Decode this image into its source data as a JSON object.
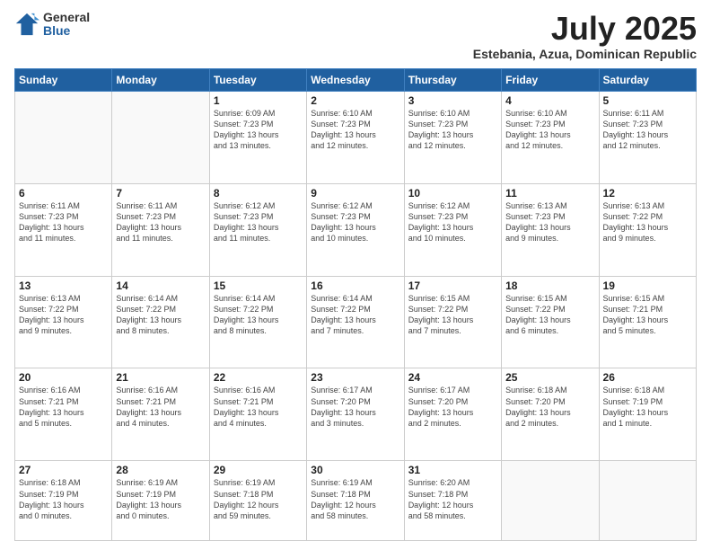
{
  "logo": {
    "general": "General",
    "blue": "Blue"
  },
  "header": {
    "month": "July 2025",
    "location": "Estebania, Azua, Dominican Republic"
  },
  "weekdays": [
    "Sunday",
    "Monday",
    "Tuesday",
    "Wednesday",
    "Thursday",
    "Friday",
    "Saturday"
  ],
  "weeks": [
    [
      {
        "day": "",
        "info": ""
      },
      {
        "day": "",
        "info": ""
      },
      {
        "day": "1",
        "info": "Sunrise: 6:09 AM\nSunset: 7:23 PM\nDaylight: 13 hours\nand 13 minutes."
      },
      {
        "day": "2",
        "info": "Sunrise: 6:10 AM\nSunset: 7:23 PM\nDaylight: 13 hours\nand 12 minutes."
      },
      {
        "day": "3",
        "info": "Sunrise: 6:10 AM\nSunset: 7:23 PM\nDaylight: 13 hours\nand 12 minutes."
      },
      {
        "day": "4",
        "info": "Sunrise: 6:10 AM\nSunset: 7:23 PM\nDaylight: 13 hours\nand 12 minutes."
      },
      {
        "day": "5",
        "info": "Sunrise: 6:11 AM\nSunset: 7:23 PM\nDaylight: 13 hours\nand 12 minutes."
      }
    ],
    [
      {
        "day": "6",
        "info": "Sunrise: 6:11 AM\nSunset: 7:23 PM\nDaylight: 13 hours\nand 11 minutes."
      },
      {
        "day": "7",
        "info": "Sunrise: 6:11 AM\nSunset: 7:23 PM\nDaylight: 13 hours\nand 11 minutes."
      },
      {
        "day": "8",
        "info": "Sunrise: 6:12 AM\nSunset: 7:23 PM\nDaylight: 13 hours\nand 11 minutes."
      },
      {
        "day": "9",
        "info": "Sunrise: 6:12 AM\nSunset: 7:23 PM\nDaylight: 13 hours\nand 10 minutes."
      },
      {
        "day": "10",
        "info": "Sunrise: 6:12 AM\nSunset: 7:23 PM\nDaylight: 13 hours\nand 10 minutes."
      },
      {
        "day": "11",
        "info": "Sunrise: 6:13 AM\nSunset: 7:23 PM\nDaylight: 13 hours\nand 9 minutes."
      },
      {
        "day": "12",
        "info": "Sunrise: 6:13 AM\nSunset: 7:22 PM\nDaylight: 13 hours\nand 9 minutes."
      }
    ],
    [
      {
        "day": "13",
        "info": "Sunrise: 6:13 AM\nSunset: 7:22 PM\nDaylight: 13 hours\nand 9 minutes."
      },
      {
        "day": "14",
        "info": "Sunrise: 6:14 AM\nSunset: 7:22 PM\nDaylight: 13 hours\nand 8 minutes."
      },
      {
        "day": "15",
        "info": "Sunrise: 6:14 AM\nSunset: 7:22 PM\nDaylight: 13 hours\nand 8 minutes."
      },
      {
        "day": "16",
        "info": "Sunrise: 6:14 AM\nSunset: 7:22 PM\nDaylight: 13 hours\nand 7 minutes."
      },
      {
        "day": "17",
        "info": "Sunrise: 6:15 AM\nSunset: 7:22 PM\nDaylight: 13 hours\nand 7 minutes."
      },
      {
        "day": "18",
        "info": "Sunrise: 6:15 AM\nSunset: 7:22 PM\nDaylight: 13 hours\nand 6 minutes."
      },
      {
        "day": "19",
        "info": "Sunrise: 6:15 AM\nSunset: 7:21 PM\nDaylight: 13 hours\nand 5 minutes."
      }
    ],
    [
      {
        "day": "20",
        "info": "Sunrise: 6:16 AM\nSunset: 7:21 PM\nDaylight: 13 hours\nand 5 minutes."
      },
      {
        "day": "21",
        "info": "Sunrise: 6:16 AM\nSunset: 7:21 PM\nDaylight: 13 hours\nand 4 minutes."
      },
      {
        "day": "22",
        "info": "Sunrise: 6:16 AM\nSunset: 7:21 PM\nDaylight: 13 hours\nand 4 minutes."
      },
      {
        "day": "23",
        "info": "Sunrise: 6:17 AM\nSunset: 7:20 PM\nDaylight: 13 hours\nand 3 minutes."
      },
      {
        "day": "24",
        "info": "Sunrise: 6:17 AM\nSunset: 7:20 PM\nDaylight: 13 hours\nand 2 minutes."
      },
      {
        "day": "25",
        "info": "Sunrise: 6:18 AM\nSunset: 7:20 PM\nDaylight: 13 hours\nand 2 minutes."
      },
      {
        "day": "26",
        "info": "Sunrise: 6:18 AM\nSunset: 7:19 PM\nDaylight: 13 hours\nand 1 minute."
      }
    ],
    [
      {
        "day": "27",
        "info": "Sunrise: 6:18 AM\nSunset: 7:19 PM\nDaylight: 13 hours\nand 0 minutes."
      },
      {
        "day": "28",
        "info": "Sunrise: 6:19 AM\nSunset: 7:19 PM\nDaylight: 13 hours\nand 0 minutes."
      },
      {
        "day": "29",
        "info": "Sunrise: 6:19 AM\nSunset: 7:18 PM\nDaylight: 12 hours\nand 59 minutes."
      },
      {
        "day": "30",
        "info": "Sunrise: 6:19 AM\nSunset: 7:18 PM\nDaylight: 12 hours\nand 58 minutes."
      },
      {
        "day": "31",
        "info": "Sunrise: 6:20 AM\nSunset: 7:18 PM\nDaylight: 12 hours\nand 58 minutes."
      },
      {
        "day": "",
        "info": ""
      },
      {
        "day": "",
        "info": ""
      }
    ]
  ]
}
